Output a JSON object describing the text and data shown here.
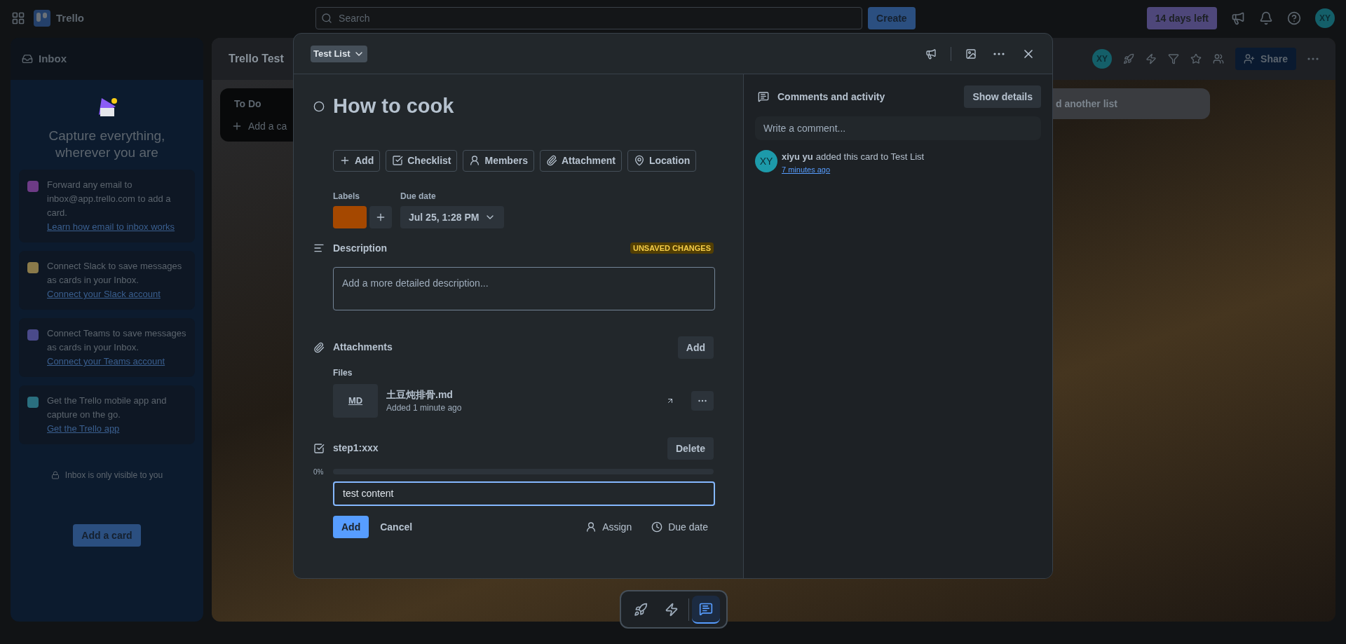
{
  "top_bar": {
    "app_name": "Trello",
    "search": {
      "placeholder": "Search"
    },
    "create_button": "Create",
    "trial_badge": "14 days left",
    "avatar": "XY"
  },
  "inbox": {
    "title": "Inbox",
    "heading": "Capture everything, wherever you are",
    "cards": [
      {
        "text": "Forward any email to inbox@app.trello.com to add a card.",
        "link": "Learn how email to inbox works",
        "color": "#6d3b86"
      },
      {
        "text": "Connect Slack to save messages as cards in your Inbox.",
        "link": "Connect your Slack account",
        "color": "#8a7a4a"
      },
      {
        "text": "Connect Teams to save messages as cards in your Inbox.",
        "link": "Connect your Teams account",
        "color": "#4a4a8a"
      },
      {
        "text": "Get the Trello mobile app and capture on the go.",
        "link": "Get the Trello app",
        "color": "#2a6f7f"
      }
    ],
    "privacy_note": "Inbox is only visible to you",
    "add_button": "Add a card"
  },
  "board": {
    "title": "Trello Test",
    "lists": [
      {
        "title": "To Do",
        "add_card": "Add a ca"
      }
    ],
    "add_list": "d another list",
    "member_avatar": "XY",
    "share_button": "Share"
  },
  "card_modal": {
    "list_button": "Test List",
    "title": "How to cook",
    "completed": false,
    "actions": [
      {
        "kind": "add",
        "label": "Add"
      },
      {
        "kind": "checklist",
        "label": "Checklist"
      },
      {
        "kind": "members",
        "label": "Members"
      },
      {
        "kind": "attachment",
        "label": "Attachment"
      },
      {
        "kind": "location",
        "label": "Location"
      }
    ],
    "labels_heading": "Labels",
    "labels": [
      {
        "color": "#a54800"
      }
    ],
    "due_date_heading": "Due date",
    "due_date": "Jul 25, 1:28 PM",
    "description": {
      "heading": "Description",
      "badge": "UNSAVED CHANGES",
      "placeholder": "Add a more detailed description..."
    },
    "attachments": {
      "heading": "Attachments",
      "add_button": "Add",
      "files_heading": "Files",
      "files": [
        {
          "type": "MD",
          "name": "土豆炖排骨.md",
          "added": "Added 1 minute ago"
        }
      ]
    },
    "checklist": {
      "title": "step1:xxx",
      "delete_button": "Delete",
      "percent": "0%",
      "level": 0,
      "new_item": "test content",
      "add_button": "Add",
      "cancel_button": "Cancel",
      "assign_button": "Assign",
      "due_date_button": "Due date"
    },
    "activity": {
      "heading": "Comments and activity",
      "show_details_button": "Show details",
      "comment_placeholder": "Write a comment...",
      "items": [
        {
          "avatar": "XY",
          "user": "xiyu yu",
          "action": "added this card to Test List",
          "time": "7 minutes ago"
        }
      ]
    }
  },
  "dock": {
    "items": [
      {
        "kind": "rocket",
        "selected": false
      },
      {
        "kind": "bolt",
        "selected": false
      },
      {
        "kind": "comment",
        "selected": true
      }
    ]
  }
}
